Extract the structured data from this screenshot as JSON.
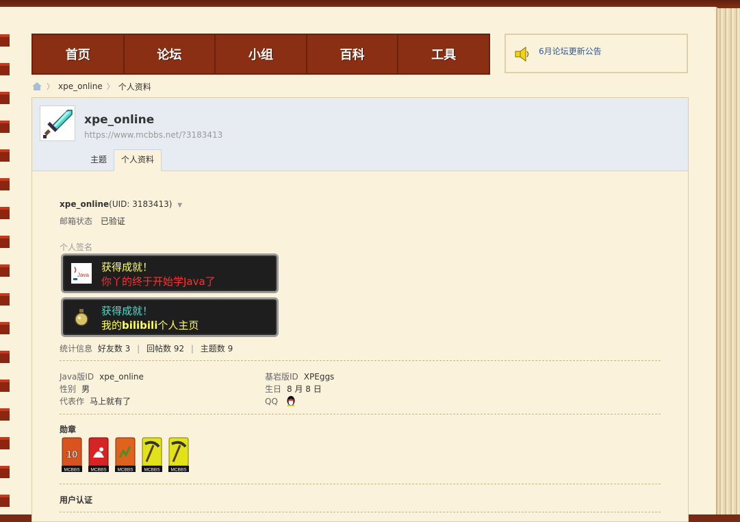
{
  "nav": {
    "items": [
      {
        "label": "首页"
      },
      {
        "label": "论坛"
      },
      {
        "label": "小组"
      },
      {
        "label": "百科"
      },
      {
        "label": "工具"
      }
    ]
  },
  "notice": {
    "text": "6月论坛更新公告"
  },
  "breadcrumb": {
    "home_icon": "home-icon",
    "user": "xpe_online",
    "current": "个人资料"
  },
  "profile": {
    "username": "xpe_online",
    "url": "https://www.mcbbs.net/?3183413",
    "tabs": [
      {
        "label": "主题"
      },
      {
        "label": "个人资料",
        "active": true
      }
    ],
    "uid_line": "(UID: 3183413)",
    "email_label": "邮箱状态",
    "email_value": "已验证",
    "signature_label": "个人签名",
    "achievements": [
      {
        "title": "获得成就！",
        "text": "你丫的终于开始学Java了",
        "title_color": "#ffff55",
        "text_color": "#ff3030",
        "icon": "java-icon"
      },
      {
        "title": "获得成就！",
        "text_prefix": "我的",
        "text_highlight": "bilibili",
        "text_suffix": "个人主页",
        "title_color": "#40e0d0",
        "text_color": "#ffff55",
        "icon": "potion-icon"
      }
    ],
    "stats": {
      "label": "统计信息",
      "friends": "好友数 3",
      "replies": "回帖数 92",
      "threads": "主题数 9"
    },
    "info_left": [
      {
        "label": "Java版ID",
        "value": "xpe_online"
      },
      {
        "label": "性别",
        "value": "男"
      },
      {
        "label": "代表作",
        "value": "马上就有了"
      }
    ],
    "info_right": [
      {
        "label": "基岩版ID",
        "value": "XPEggs"
      },
      {
        "label": "生日",
        "value": "8 月 8 日"
      },
      {
        "label": "QQ",
        "value": ""
      }
    ],
    "medals_title": "勋章",
    "medal_caption": "MCBBS",
    "medals": [
      "10",
      "red",
      "orange",
      "pickaxe",
      "pickaxe"
    ],
    "verify_title": "用户认证"
  }
}
